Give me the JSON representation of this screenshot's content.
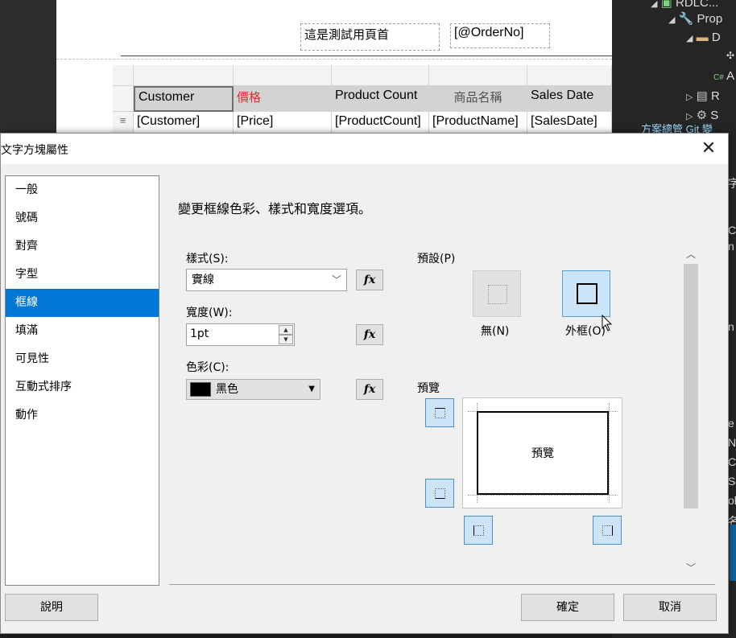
{
  "designer": {
    "header_text": "這是測試用頁首",
    "header_param": "[@OrderNo]",
    "table": {
      "columns": [
        "Customer",
        "價格",
        "Product Count",
        "商品名稱",
        "Sales Date"
      ],
      "cells": [
        "[Customer]",
        "[Price]",
        "[ProductCount]",
        "[ProductName]",
        "[SalesDate]"
      ],
      "row_handle": "≡",
      "price_header_color": "#e03030"
    }
  },
  "solution_explorer": {
    "items": [
      {
        "text": "RDLC..."
      },
      {
        "text": "Prop"
      },
      {
        "text": "D"
      },
      {
        "text": "A"
      },
      {
        "text": "R"
      },
      {
        "text": "S"
      }
    ],
    "tabs": "方案總管  Git 變",
    "edge_letters": [
      "字",
      "C",
      "n",
      "n",
      "e",
      "N",
      "C",
      "S",
      "ol",
      "名"
    ]
  },
  "dialog": {
    "title": "文字方塊屬性",
    "close_glyph": "✕",
    "nav_items": [
      "一般",
      "號碼",
      "對齊",
      "字型",
      "框線",
      "填滿",
      "可見性",
      "互動式排序",
      "動作"
    ],
    "selected_nav": "框線",
    "heading": "變更框線色彩、樣式和寬度選項。",
    "style": {
      "label": "樣式(S):",
      "value": "實線"
    },
    "width": {
      "label": "寬度(W):",
      "value": "1pt"
    },
    "color": {
      "label": "色彩(C):",
      "value": "黑色",
      "swatch": "#000000"
    },
    "fx_label": "fx",
    "presets": {
      "label": "預設(P)",
      "none": "無(N)",
      "outline": "外框(O)"
    },
    "preview": {
      "label": "預覽",
      "text": "預覽"
    },
    "buttons": {
      "help": "說明",
      "ok": "確定",
      "cancel": "取消"
    },
    "accent_color": "#0078d7"
  }
}
